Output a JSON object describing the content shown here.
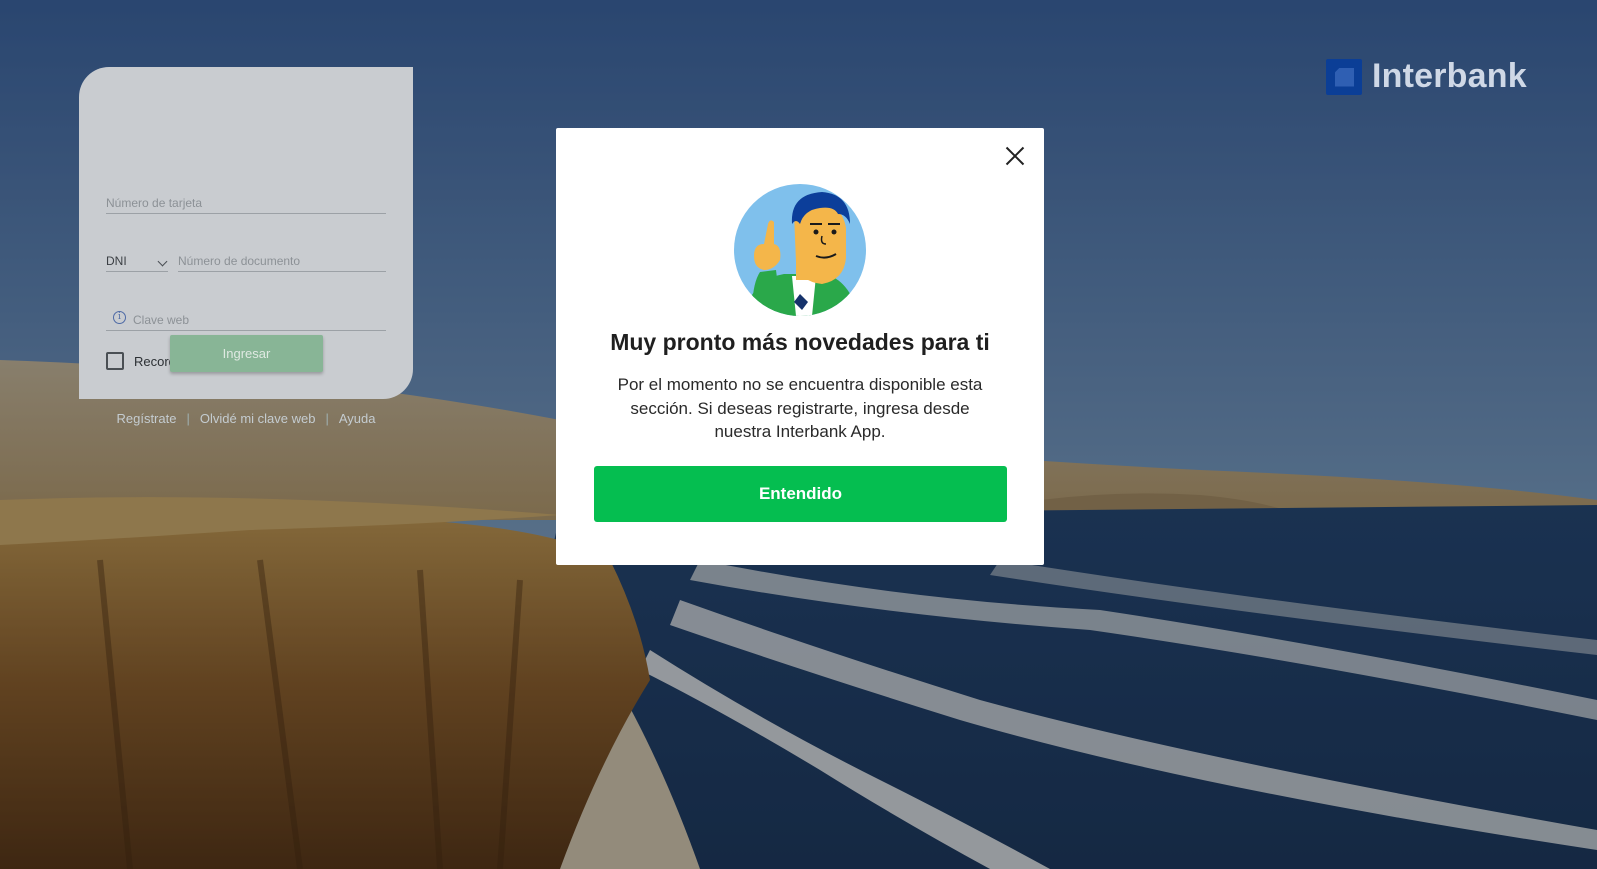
{
  "brand": {
    "name": "Interbank"
  },
  "login": {
    "card_placeholder": "Número de tarjeta",
    "doc_type": "DNI",
    "doc_placeholder": "Número de documento",
    "password_placeholder": "Clave web",
    "remember_label": "Recordar datos",
    "submit_label": "Ingresar",
    "footer_links": [
      "Regístrate",
      "Olvidé mi clave web",
      "Ayuda"
    ],
    "footer_separator": "|"
  },
  "modal": {
    "title": "Muy pronto más novedades para ti",
    "message": "Por el momento no se encuentra disponible esta sección. Si deseas registrarte, ingresa desde nuestra Interbank App.",
    "button_label": "Entendido"
  },
  "colors": {
    "accent_green": "#05be50",
    "brand_blue": "#0b3e96",
    "disabled_green": "#88b596"
  },
  "icons": [
    "close-icon",
    "info-icon",
    "chevron-down-icon",
    "checkbox-icon",
    "interbank-logo-icon"
  ]
}
